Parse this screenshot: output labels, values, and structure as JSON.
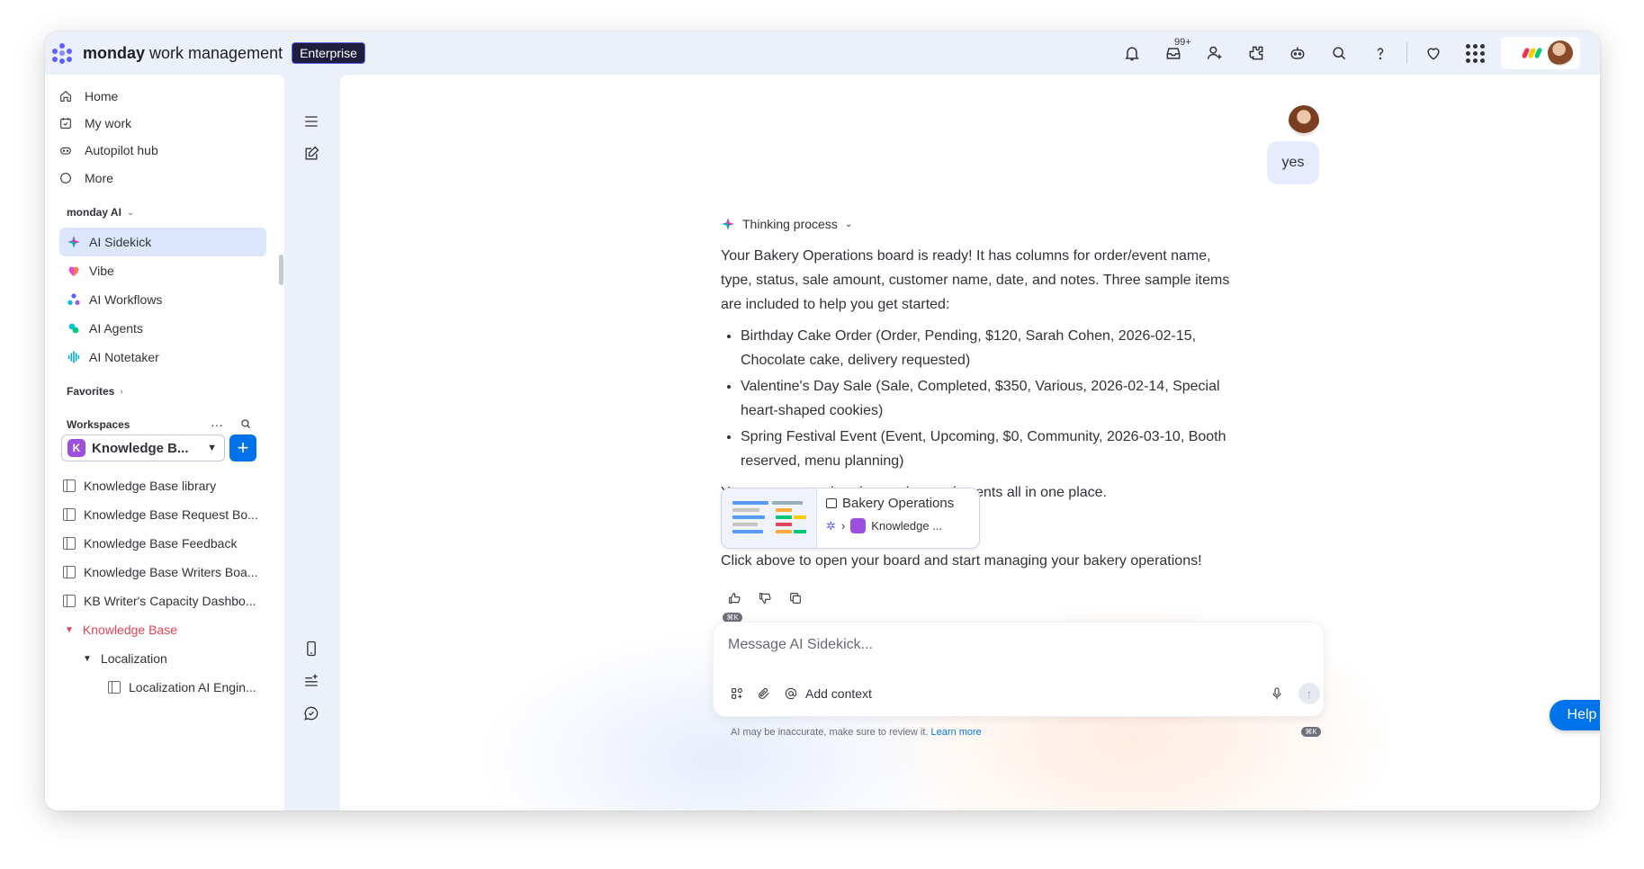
{
  "app": {
    "brand_bold": "monday",
    "brand_rest": " work management",
    "plan_badge": "Enterprise",
    "notification_count": "99+"
  },
  "sidebar": {
    "nav": [
      {
        "label": "Home",
        "icon": "home-icon"
      },
      {
        "label": "My work",
        "icon": "calendar-check-icon"
      },
      {
        "label": "Autopilot hub",
        "icon": "robot-icon"
      },
      {
        "label": "More",
        "icon": "more-circle-icon"
      }
    ],
    "ai_section_label": "monday AI",
    "ai_items": [
      {
        "label": "AI Sidekick",
        "active": true
      },
      {
        "label": "Vibe",
        "active": false
      },
      {
        "label": "AI Workflows",
        "active": false
      },
      {
        "label": "AI Agents",
        "active": false
      },
      {
        "label": "AI Notetaker",
        "active": false
      }
    ],
    "favorites_label": "Favorites",
    "workspaces_label": "Workspaces",
    "workspace_name": "Knowledge B...",
    "workspace_initial": "K",
    "boards": [
      "Knowledge Base library",
      "Knowledge Base Request Bo...",
      "Knowledge Base Feedback",
      "Knowledge Base Writers Boa...",
      "KB Writer's Capacity Dashbo..."
    ],
    "folder_name": "Knowledge Base",
    "subfolder_name": "Localization",
    "subboard_name": "Localization AI Engin..."
  },
  "chat": {
    "user_message": "yes",
    "thinking_label": "Thinking process",
    "reply_intro": "Your Bakery Operations board is ready! It has columns for order/event name, type, status, sale amount, customer name, date, and notes. Three sample items are included to help you get started:",
    "reply_items": [
      "Birthday Cake Order (Order, Pending, $120, Sarah Cohen, 2026-02-15, Chocolate cake, delivery requested)",
      "Valentine's Day Sale (Sale, Completed, $350, Various, 2026-02-14, Special heart-shaped cookies)",
      "Spring Festival Event (Event, Upcoming, $0, Community, 2026-03-10, Booth reserved, menu planning)"
    ],
    "reply_after": "You can now track orders, sales, and events all in one place.",
    "card_title": "Bakery Operations",
    "card_path": "Knowledge ...",
    "cta": "Click above to open your board and start managing your bakery operations!",
    "composer_placeholder": "Message AI Sidekick...",
    "add_context": "Add context",
    "disclaimer": "AI may be inaccurate, make sure to review it.",
    "learn_more": "Learn more",
    "help": "Help"
  },
  "colors": {
    "accent": "#0073ea",
    "active_bg": "#dce7fd",
    "pink": "#e44258",
    "workspace": "#9d50dd"
  }
}
